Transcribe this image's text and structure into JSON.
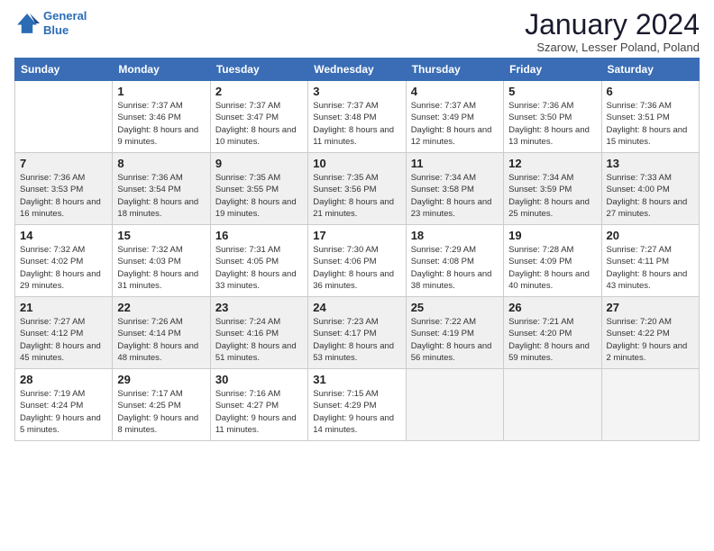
{
  "logo": {
    "line1": "General",
    "line2": "Blue"
  },
  "title": "January 2024",
  "location": "Szarow, Lesser Poland, Poland",
  "days_of_week": [
    "Sunday",
    "Monday",
    "Tuesday",
    "Wednesday",
    "Thursday",
    "Friday",
    "Saturday"
  ],
  "weeks": [
    [
      {
        "day": "",
        "info": ""
      },
      {
        "day": "1",
        "info": "Sunrise: 7:37 AM\nSunset: 3:46 PM\nDaylight: 8 hours\nand 9 minutes."
      },
      {
        "day": "2",
        "info": "Sunrise: 7:37 AM\nSunset: 3:47 PM\nDaylight: 8 hours\nand 10 minutes."
      },
      {
        "day": "3",
        "info": "Sunrise: 7:37 AM\nSunset: 3:48 PM\nDaylight: 8 hours\nand 11 minutes."
      },
      {
        "day": "4",
        "info": "Sunrise: 7:37 AM\nSunset: 3:49 PM\nDaylight: 8 hours\nand 12 minutes."
      },
      {
        "day": "5",
        "info": "Sunrise: 7:36 AM\nSunset: 3:50 PM\nDaylight: 8 hours\nand 13 minutes."
      },
      {
        "day": "6",
        "info": "Sunrise: 7:36 AM\nSunset: 3:51 PM\nDaylight: 8 hours\nand 15 minutes."
      }
    ],
    [
      {
        "day": "7",
        "info": "Sunrise: 7:36 AM\nSunset: 3:53 PM\nDaylight: 8 hours\nand 16 minutes."
      },
      {
        "day": "8",
        "info": "Sunrise: 7:36 AM\nSunset: 3:54 PM\nDaylight: 8 hours\nand 18 minutes."
      },
      {
        "day": "9",
        "info": "Sunrise: 7:35 AM\nSunset: 3:55 PM\nDaylight: 8 hours\nand 19 minutes."
      },
      {
        "day": "10",
        "info": "Sunrise: 7:35 AM\nSunset: 3:56 PM\nDaylight: 8 hours\nand 21 minutes."
      },
      {
        "day": "11",
        "info": "Sunrise: 7:34 AM\nSunset: 3:58 PM\nDaylight: 8 hours\nand 23 minutes."
      },
      {
        "day": "12",
        "info": "Sunrise: 7:34 AM\nSunset: 3:59 PM\nDaylight: 8 hours\nand 25 minutes."
      },
      {
        "day": "13",
        "info": "Sunrise: 7:33 AM\nSunset: 4:00 PM\nDaylight: 8 hours\nand 27 minutes."
      }
    ],
    [
      {
        "day": "14",
        "info": "Sunrise: 7:32 AM\nSunset: 4:02 PM\nDaylight: 8 hours\nand 29 minutes."
      },
      {
        "day": "15",
        "info": "Sunrise: 7:32 AM\nSunset: 4:03 PM\nDaylight: 8 hours\nand 31 minutes."
      },
      {
        "day": "16",
        "info": "Sunrise: 7:31 AM\nSunset: 4:05 PM\nDaylight: 8 hours\nand 33 minutes."
      },
      {
        "day": "17",
        "info": "Sunrise: 7:30 AM\nSunset: 4:06 PM\nDaylight: 8 hours\nand 36 minutes."
      },
      {
        "day": "18",
        "info": "Sunrise: 7:29 AM\nSunset: 4:08 PM\nDaylight: 8 hours\nand 38 minutes."
      },
      {
        "day": "19",
        "info": "Sunrise: 7:28 AM\nSunset: 4:09 PM\nDaylight: 8 hours\nand 40 minutes."
      },
      {
        "day": "20",
        "info": "Sunrise: 7:27 AM\nSunset: 4:11 PM\nDaylight: 8 hours\nand 43 minutes."
      }
    ],
    [
      {
        "day": "21",
        "info": "Sunrise: 7:27 AM\nSunset: 4:12 PM\nDaylight: 8 hours\nand 45 minutes."
      },
      {
        "day": "22",
        "info": "Sunrise: 7:26 AM\nSunset: 4:14 PM\nDaylight: 8 hours\nand 48 minutes."
      },
      {
        "day": "23",
        "info": "Sunrise: 7:24 AM\nSunset: 4:16 PM\nDaylight: 8 hours\nand 51 minutes."
      },
      {
        "day": "24",
        "info": "Sunrise: 7:23 AM\nSunset: 4:17 PM\nDaylight: 8 hours\nand 53 minutes."
      },
      {
        "day": "25",
        "info": "Sunrise: 7:22 AM\nSunset: 4:19 PM\nDaylight: 8 hours\nand 56 minutes."
      },
      {
        "day": "26",
        "info": "Sunrise: 7:21 AM\nSunset: 4:20 PM\nDaylight: 8 hours\nand 59 minutes."
      },
      {
        "day": "27",
        "info": "Sunrise: 7:20 AM\nSunset: 4:22 PM\nDaylight: 9 hours\nand 2 minutes."
      }
    ],
    [
      {
        "day": "28",
        "info": "Sunrise: 7:19 AM\nSunset: 4:24 PM\nDaylight: 9 hours\nand 5 minutes."
      },
      {
        "day": "29",
        "info": "Sunrise: 7:17 AM\nSunset: 4:25 PM\nDaylight: 9 hours\nand 8 minutes."
      },
      {
        "day": "30",
        "info": "Sunrise: 7:16 AM\nSunset: 4:27 PM\nDaylight: 9 hours\nand 11 minutes."
      },
      {
        "day": "31",
        "info": "Sunrise: 7:15 AM\nSunset: 4:29 PM\nDaylight: 9 hours\nand 14 minutes."
      },
      {
        "day": "",
        "info": ""
      },
      {
        "day": "",
        "info": ""
      },
      {
        "day": "",
        "info": ""
      }
    ]
  ]
}
